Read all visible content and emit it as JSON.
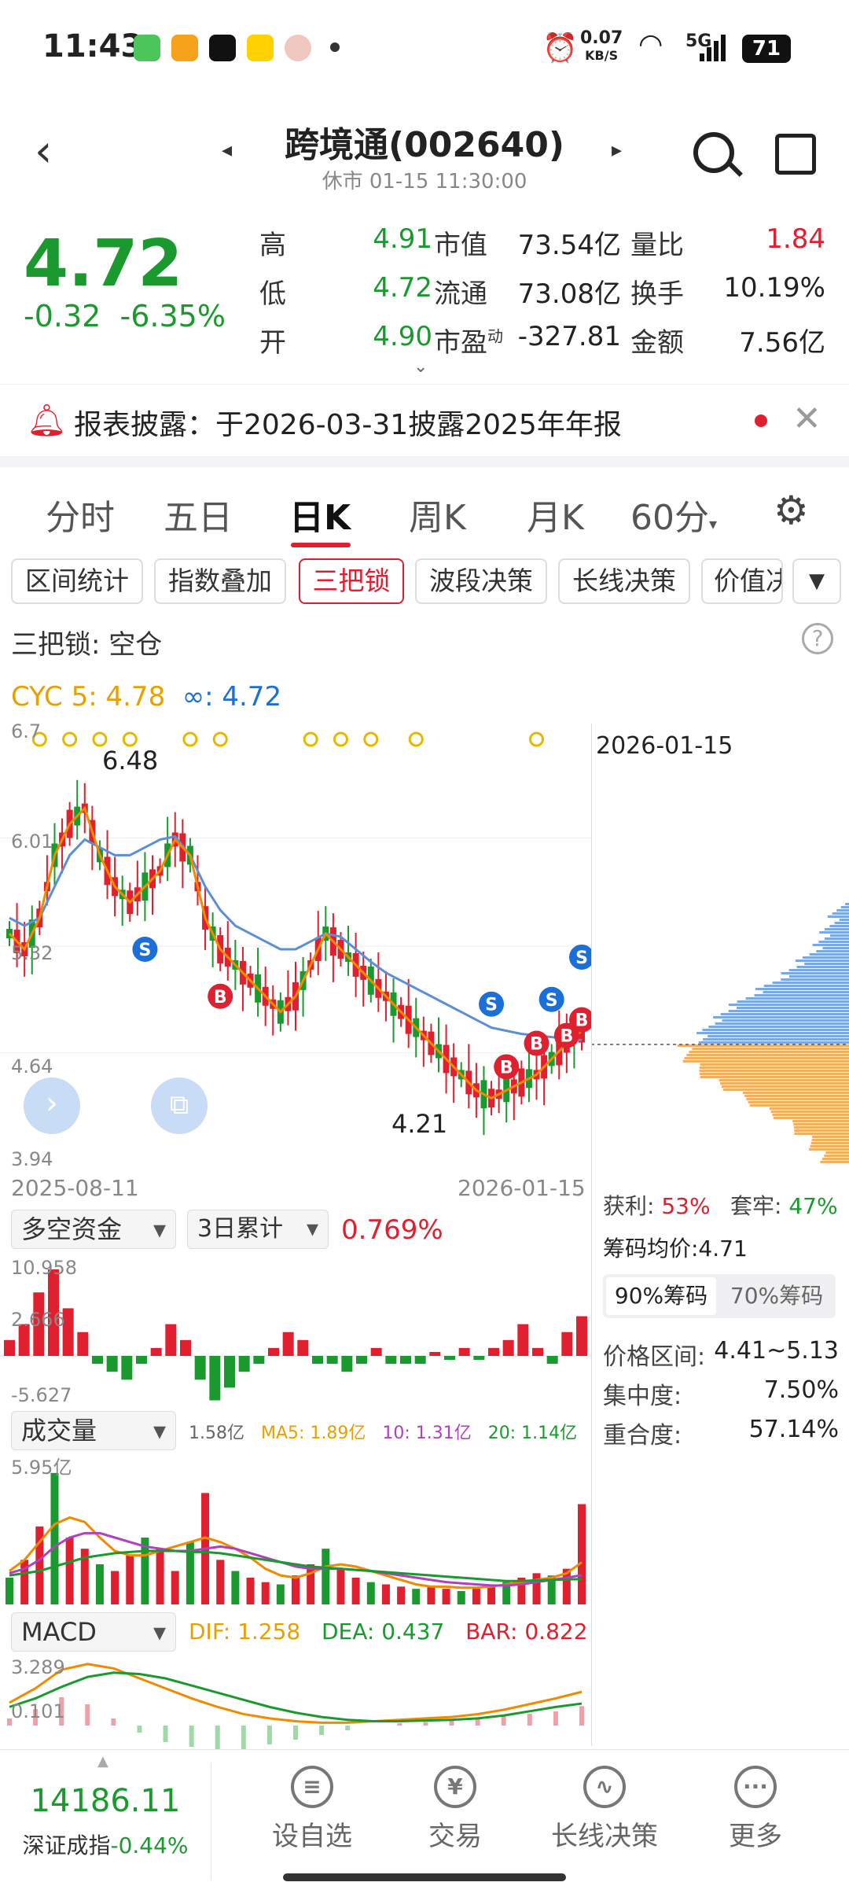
{
  "status": {
    "time": "11:43",
    "net_speed": "0.07",
    "net_unit": "KB/S",
    "signal": "5G",
    "battery": "71",
    "icons": [
      "message-app-icon",
      "video-app-icon",
      "tiktok-icon",
      "meituan-icon",
      "avatar-app-icon",
      "dot-icon",
      "alarm-icon",
      "wifi-icon",
      "signal-icon",
      "battery-icon"
    ]
  },
  "header": {
    "title": "跨境通(002640)",
    "subtitle": "休市 01-15 11:30:00"
  },
  "quote": {
    "price": "4.72",
    "change": "-0.32",
    "change_pct": "-6.35%",
    "rows": [
      {
        "l1": "高",
        "v1": "4.91",
        "l2": "市值",
        "v2": "73.54亿",
        "l3": "量比",
        "v3": "1.84"
      },
      {
        "l1": "低",
        "v1": "4.72",
        "l2": "流通",
        "v2": "73.08亿",
        "l3": "换手",
        "v3": "10.19%"
      },
      {
        "l1": "开",
        "v1": "4.90",
        "l2": "市盈",
        "l2sup": "动",
        "v2": "-327.81",
        "l3": "金额",
        "v3": "7.56亿"
      }
    ]
  },
  "notice": {
    "text": "报表披露：于2026-03-31披露2025年年报"
  },
  "tabs": [
    "分时",
    "五日",
    "日K",
    "周K",
    "月K",
    "60分"
  ],
  "active_tab": 2,
  "chips": [
    "区间统计",
    "指数叠加",
    "三把锁",
    "波段决策",
    "长线决策",
    "价值决"
  ],
  "active_chip": 2,
  "lock_status": "三把锁: 空仓",
  "indicator": {
    "cyc_label": "CYC 5: 4.78",
    "inf_label": "∞: 4.72"
  },
  "chart_data": [
    {
      "type": "line",
      "title": "",
      "y_ticks": [
        "6.7",
        "6.01",
        "5.32",
        "4.64",
        "3.94"
      ],
      "x_labels": [
        "2025-08-11",
        "2026-01-15"
      ],
      "annotations": [
        "6.48",
        "4.21"
      ],
      "series": [
        {
          "name": "CYC 5",
          "color": "#f08a00",
          "values": [
            5.4,
            5.3,
            5.5,
            5.9,
            6.1,
            6.2,
            5.9,
            5.7,
            5.6,
            5.7,
            5.8,
            6.0,
            5.9,
            5.5,
            5.3,
            5.2,
            5.1,
            5.0,
            4.9,
            5.0,
            5.2,
            5.4,
            5.3,
            5.2,
            5.1,
            5.0,
            4.9,
            4.8,
            4.7,
            4.6,
            4.5,
            4.4,
            4.35,
            4.4,
            4.45,
            4.5,
            4.6,
            4.7,
            4.78
          ]
        },
        {
          "name": "∞",
          "color": "#5b8fd6",
          "values": [
            5.5,
            5.45,
            5.5,
            5.7,
            5.9,
            6.0,
            5.95,
            5.9,
            5.9,
            5.95,
            6.0,
            6.02,
            5.9,
            5.7,
            5.55,
            5.45,
            5.4,
            5.35,
            5.3,
            5.3,
            5.35,
            5.4,
            5.38,
            5.3,
            5.22,
            5.15,
            5.1,
            5.05,
            5.0,
            4.95,
            4.9,
            4.85,
            4.8,
            4.78,
            4.76,
            4.75,
            4.74,
            4.73,
            4.72
          ]
        }
      ]
    },
    {
      "type": "bar",
      "title": "",
      "y_ticks": [
        "10.958",
        "2.666",
        "-5.627"
      ],
      "series": [
        {
          "name": "多空资金",
          "values": [
            2,
            4,
            8,
            10.9,
            6,
            3,
            -1,
            -2,
            -3,
            -1,
            1,
            4,
            2,
            -3,
            -5.6,
            -4,
            -2,
            -1,
            1,
            3,
            2,
            -1,
            -1,
            -2,
            -1,
            1,
            -1,
            -1,
            -1,
            0.5,
            -0.5,
            1,
            -0.5,
            1,
            2,
            4,
            1,
            -1,
            3,
            5
          ]
        }
      ]
    },
    {
      "type": "bar",
      "title": "",
      "y_ticks": [
        "5.95亿"
      ],
      "series": [
        {
          "name": "成交量",
          "values": [
            1.2,
            2.0,
            3.5,
            5.9,
            3.0,
            2.5,
            1.8,
            1.5,
            2.2,
            3.0,
            2.5,
            1.5,
            2.8,
            5.0,
            2.0,
            1.5,
            1.2,
            1.0,
            0.9,
            1.3,
            1.8,
            2.5,
            1.6,
            1.2,
            1.0,
            0.9,
            0.8,
            0.7,
            0.8,
            0.7,
            0.6,
            0.7,
            0.8,
            1.0,
            1.2,
            1.4,
            1.3,
            1.6,
            4.5
          ]
        },
        {
          "name": "MA5",
          "values": [
            1.5,
            2.0,
            2.8,
            3.6,
            3.9,
            3.7,
            3.0,
            2.4,
            2.2,
            2.2,
            2.4,
            2.6,
            2.8,
            3.0,
            2.8,
            2.5,
            2.1,
            1.6,
            1.3,
            1.2,
            1.4,
            1.7,
            1.8,
            1.7,
            1.5,
            1.3,
            1.1,
            0.9,
            0.8,
            0.8,
            0.75,
            0.75,
            0.8,
            0.9,
            1.0,
            1.1,
            1.2,
            1.4,
            1.89
          ]
        },
        {
          "name": "10",
          "values": [
            1.4,
            1.6,
            2.0,
            2.6,
            3.0,
            3.2,
            3.2,
            3.0,
            2.8,
            2.6,
            2.5,
            2.4,
            2.4,
            2.5,
            2.6,
            2.5,
            2.3,
            2.1,
            1.9,
            1.7,
            1.6,
            1.6,
            1.6,
            1.55,
            1.5,
            1.4,
            1.3,
            1.2,
            1.1,
            1.0,
            0.95,
            0.9,
            0.85,
            0.85,
            0.9,
            1.0,
            1.1,
            1.2,
            1.31
          ]
        },
        {
          "name": "20",
          "values": [
            1.3,
            1.4,
            1.5,
            1.7,
            1.9,
            2.1,
            2.2,
            2.3,
            2.35,
            2.4,
            2.4,
            2.4,
            2.35,
            2.35,
            2.3,
            2.2,
            2.1,
            2.0,
            1.9,
            1.8,
            1.7,
            1.65,
            1.6,
            1.55,
            1.5,
            1.45,
            1.4,
            1.35,
            1.3,
            1.25,
            1.2,
            1.15,
            1.1,
            1.05,
            1.05,
            1.08,
            1.1,
            1.12,
            1.14
          ]
        }
      ]
    },
    {
      "type": "line",
      "title": "",
      "y_ticks": [
        "3.289",
        "0.101"
      ],
      "series": [
        {
          "name": "DIF",
          "values": [
            0.5,
            1.5,
            2.8,
            3.2,
            2.9,
            2.2,
            1.5,
            0.8,
            0.2,
            -0.3,
            -0.6,
            -0.8,
            -0.9,
            -0.9,
            -0.8,
            -0.7,
            -0.6,
            -0.5,
            -0.3,
            0.0,
            0.4,
            0.8,
            1.258
          ]
        },
        {
          "name": "DEA",
          "values": [
            0.2,
            0.8,
            1.6,
            2.3,
            2.6,
            2.5,
            2.2,
            1.7,
            1.2,
            0.7,
            0.2,
            -0.2,
            -0.5,
            -0.7,
            -0.8,
            -0.8,
            -0.75,
            -0.7,
            -0.6,
            -0.4,
            -0.1,
            0.2,
            0.437
          ]
        }
      ]
    }
  ],
  "chart_date": "2026-01-15",
  "money_flow": {
    "label": "多空资金",
    "period": "3日累计",
    "value": "0.769%"
  },
  "volume": {
    "label": "成交量",
    "vol": "1.58亿",
    "ma5": "MA5: 1.89亿",
    "ma10": "10: 1.31亿",
    "ma20": "20: 1.14亿"
  },
  "macd": {
    "label": "MACD",
    "dif": "DIF: 1.258",
    "dea": "DEA: 0.437",
    "bar": "BAR: 0.822"
  },
  "chips_panel": {
    "profit_label": "获利:",
    "profit": "53%",
    "trapped_label": "套牢:",
    "trapped": "47%",
    "avg_cost": "筹码均价:4.71",
    "tab90": "90%筹码",
    "tab70": "70%筹码",
    "range_label": "价格区间:",
    "range": "4.41~5.13",
    "conc_label": "集中度:",
    "conc": "7.50%",
    "overlap_label": "重合度:",
    "overlap": "57.14%"
  },
  "index": {
    "value": "14186.11",
    "name": "深证成指",
    "change": "-0.44%"
  },
  "nav": [
    {
      "label": "设自选",
      "glyph": "≡"
    },
    {
      "label": "交易",
      "glyph": "¥"
    },
    {
      "label": "长线决策",
      "glyph": "∿"
    },
    {
      "label": "更多",
      "glyph": "···"
    }
  ],
  "colors": {
    "up": "#e0202e",
    "down": "#1a9a2e",
    "ma_orange": "#f08a00",
    "ma_blue": "#5b8fd6",
    "accent_blue": "#1a6fd8"
  }
}
